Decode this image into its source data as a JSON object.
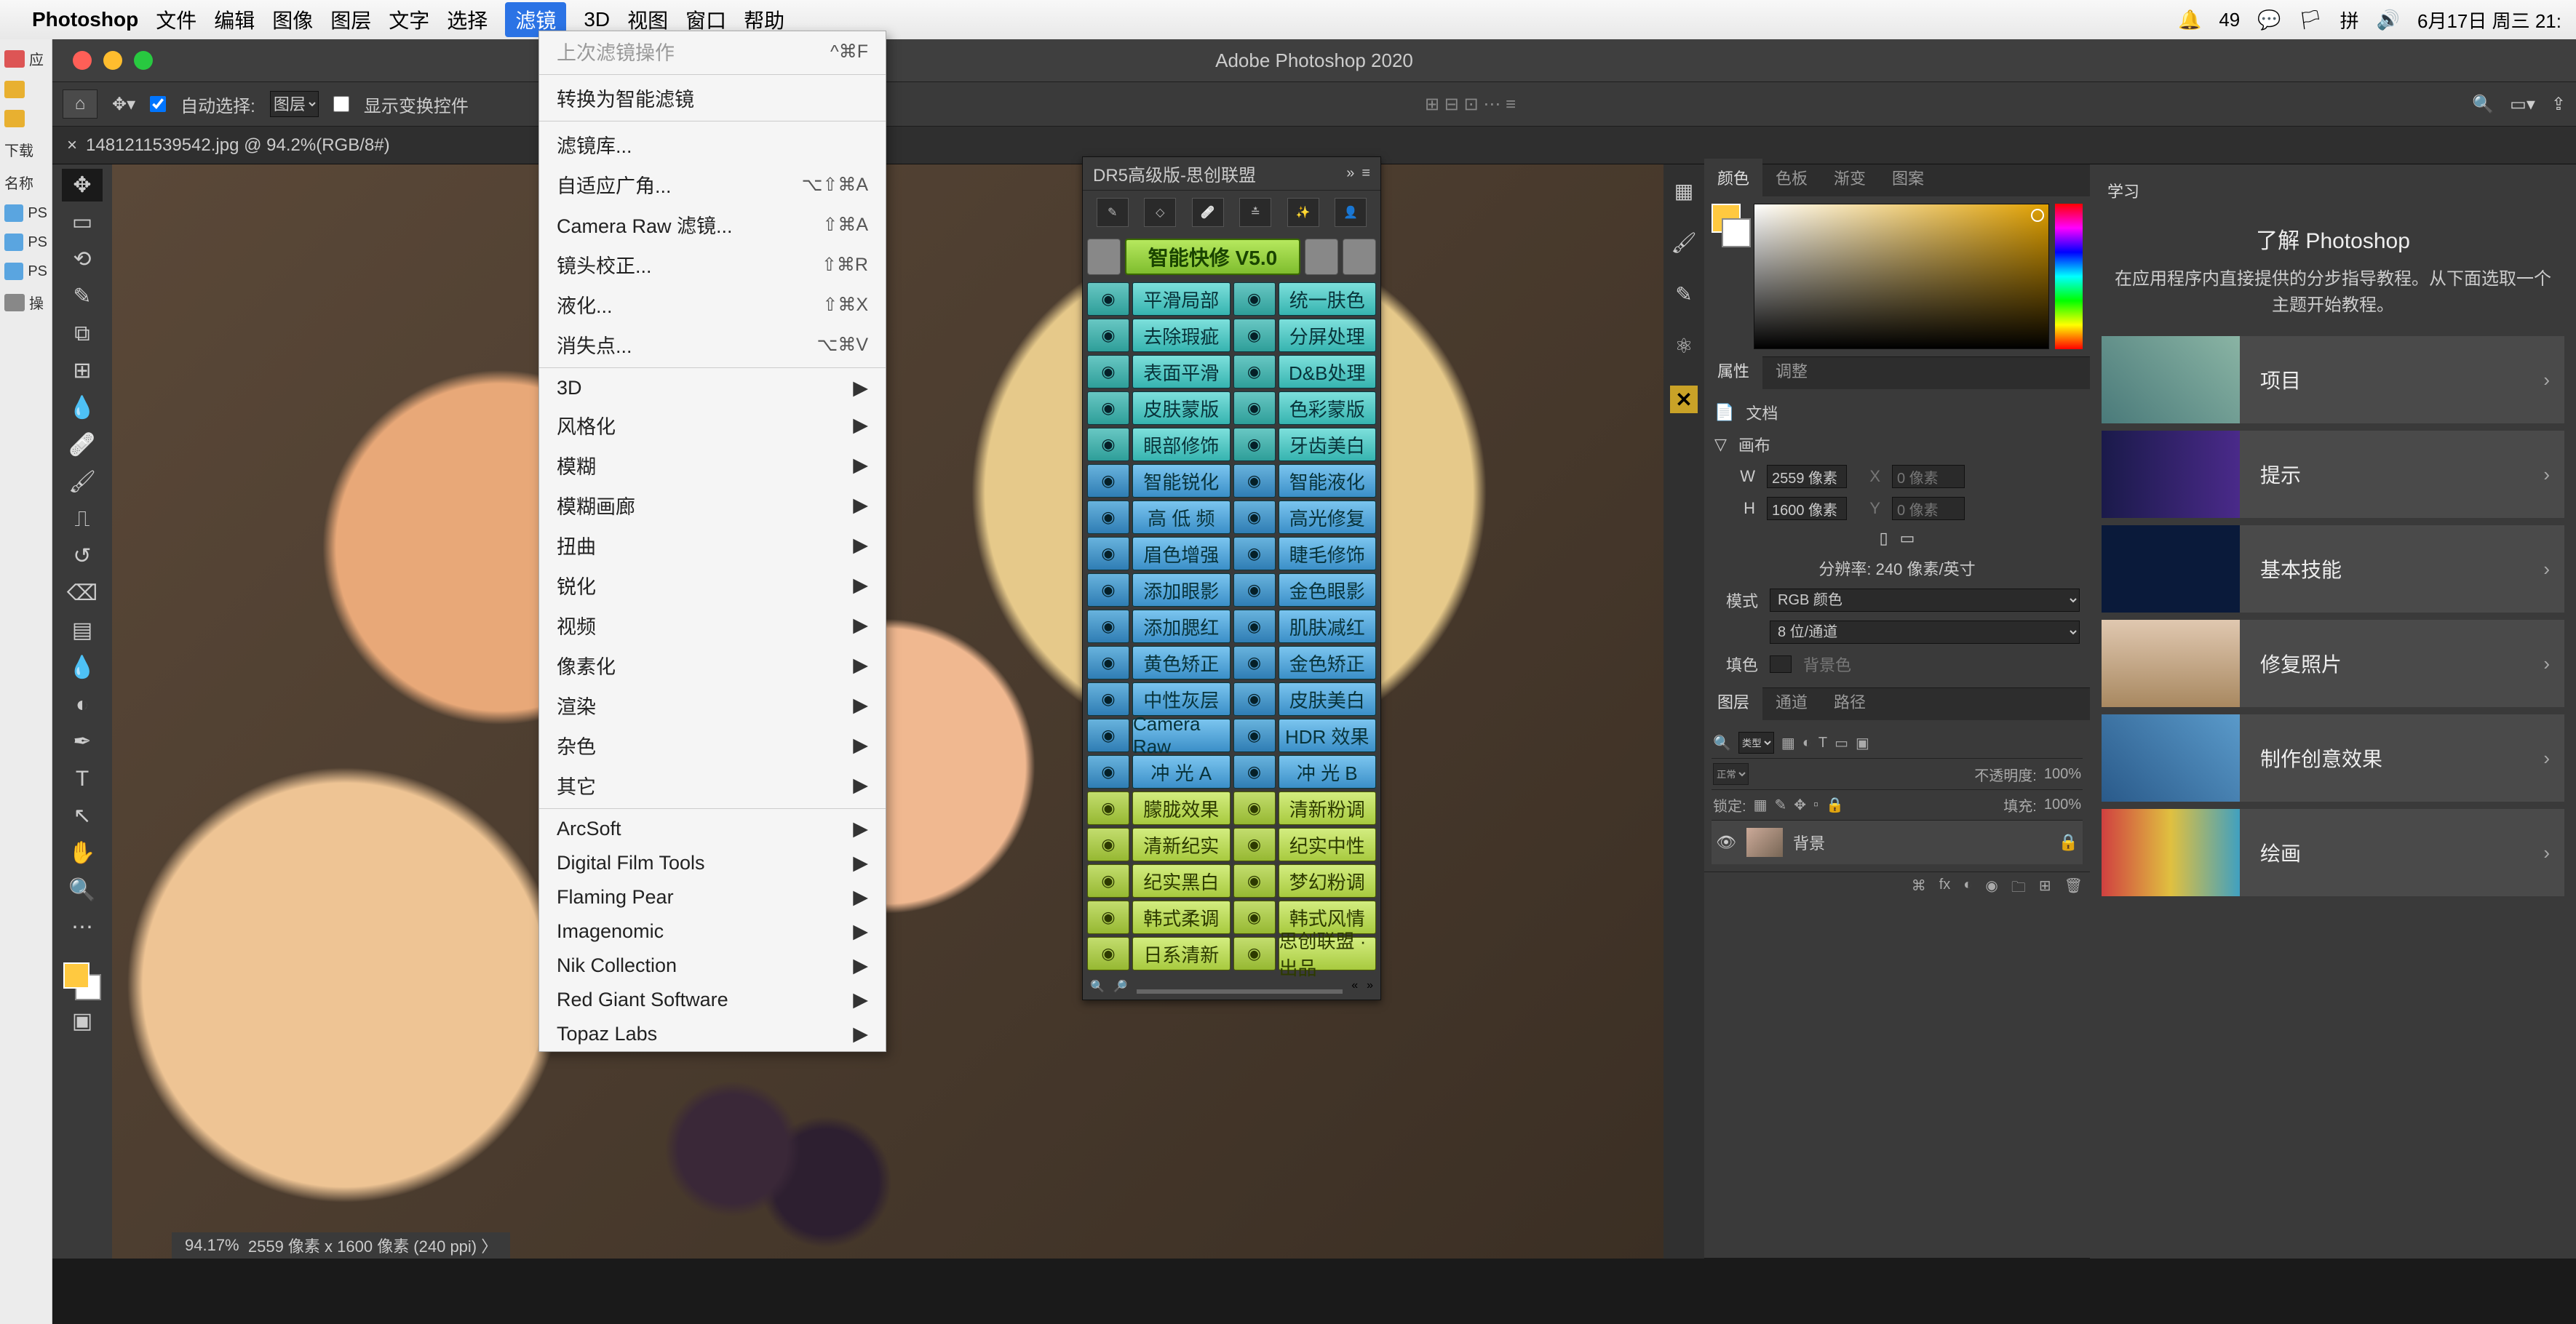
{
  "menubar": {
    "app": "Photoshop",
    "items": [
      "文件",
      "编辑",
      "图像",
      "图层",
      "文字",
      "选择",
      "滤镜",
      "3D",
      "视图",
      "窗口",
      "帮助"
    ],
    "active_index": 6,
    "right": [
      "🔔",
      "49",
      "💬",
      "🏳",
      "拼",
      "🔊",
      "6月17日 周三 21:"
    ]
  },
  "finder": {
    "items": [
      "应",
      "",
      "",
      "下载",
      "名称",
      "PS",
      "PS",
      "PS",
      "操"
    ]
  },
  "window_title": "Adobe Photoshop 2020",
  "optionsbar": {
    "auto_select": "自动选择:",
    "layer_dropdown": "图层",
    "show_transform": "显示变换控件"
  },
  "tab": {
    "name": "1481211539542.jpg @ 94.2%(RGB/8#)",
    "close": "×"
  },
  "filter_menu": {
    "last": "上次滤镜操作",
    "last_sc": "^⌘F",
    "smart": "转换为智能滤镜",
    "group1": [
      {
        "l": "滤镜库...",
        "sc": ""
      },
      {
        "l": "自适应广角...",
        "sc": "⌥⇧⌘A"
      },
      {
        "l": "Camera Raw 滤镜...",
        "sc": "⇧⌘A"
      },
      {
        "l": "镜头校正...",
        "sc": "⇧⌘R"
      },
      {
        "l": "液化...",
        "sc": "⇧⌘X"
      },
      {
        "l": "消失点...",
        "sc": "⌥⌘V"
      }
    ],
    "group2": [
      "3D",
      "风格化",
      "模糊",
      "模糊画廊",
      "扭曲",
      "锐化",
      "视频",
      "像素化",
      "渲染",
      "杂色",
      "其它"
    ],
    "group3": [
      "ArcSoft",
      "Digital Film Tools",
      "Flaming Pear",
      "Imagenomic",
      "Nik Collection",
      "Red Giant Software",
      "Topaz Labs"
    ]
  },
  "plugin": {
    "title": "DR5高级版-思创联盟",
    "main_btn": "智能快修 V5.0",
    "rows": [
      [
        "平滑局部",
        "统一肤色",
        "teal"
      ],
      [
        "去除瑕疵",
        "分屏处理",
        "teal"
      ],
      [
        "表面平滑",
        "D&B处理",
        "teal"
      ],
      [
        "皮肤蒙版",
        "色彩蒙版",
        "teal"
      ],
      [
        "眼部修饰",
        "牙齿美白",
        "teal"
      ],
      [
        "智能锐化",
        "智能液化",
        "blue"
      ],
      [
        "高 低 频",
        "高光修复",
        "blue"
      ],
      [
        "眉色增强",
        "睫毛修饰",
        "blue"
      ],
      [
        "添加眼影",
        "金色眼影",
        "blue"
      ],
      [
        "添加腮红",
        "肌肤减红",
        "blue"
      ],
      [
        "黄色矫正",
        "金色矫正",
        "blue"
      ],
      [
        "中性灰层",
        "皮肤美白",
        "blue"
      ],
      [
        "Camera Raw",
        "HDR 效果",
        "blue"
      ],
      [
        "冲 光 A",
        "冲 光 B",
        "blue"
      ],
      [
        "朦胧效果",
        "清新粉调",
        "lime"
      ],
      [
        "清新纪实",
        "纪实中性",
        "lime"
      ],
      [
        "纪实黑白",
        "梦幻粉调",
        "lime"
      ],
      [
        "韩式柔调",
        "韩式风情",
        "lime"
      ],
      [
        "日系清新",
        "思创联盟 · 出品",
        "lime"
      ]
    ]
  },
  "color_tabs": [
    "颜色",
    "色板",
    "渐变",
    "图案"
  ],
  "props": {
    "tabs": [
      "属性",
      "调整"
    ],
    "doc": "文档",
    "canvas": "画布",
    "w_lab": "W",
    "w": "2559 像素",
    "x_lab": "X",
    "x": "0 像素",
    "h_lab": "H",
    "h": "1600 像素",
    "y_lab": "Y",
    "y": "0 像素",
    "res": "分辨率: 240 像素/英寸",
    "mode_lab": "模式",
    "mode": "RGB 颜色",
    "depth": "8 位/通道",
    "fill_lab": "填色",
    "fill": "背景色"
  },
  "layers": {
    "tabs": [
      "图层",
      "通道",
      "路径"
    ],
    "kind": "类型",
    "blend": "正常",
    "opacity_lab": "不透明度:",
    "opacity": "100%",
    "lock_lab": "锁定:",
    "fill_lab": "填充:",
    "fill": "100%",
    "layer_name": "背景"
  },
  "learn": {
    "tab": "学习",
    "title": "了解 Photoshop",
    "sub": "在应用程序内直接提供的分步指导教程。从下面选取一个主题开始教程。",
    "cards": [
      "项目",
      "提示",
      "基本技能",
      "修复照片",
      "制作创意效果",
      "绘画"
    ]
  },
  "status": {
    "zoom": "94.17%",
    "dims": "2559 像素 x 1600 像素 (240 ppi)"
  }
}
